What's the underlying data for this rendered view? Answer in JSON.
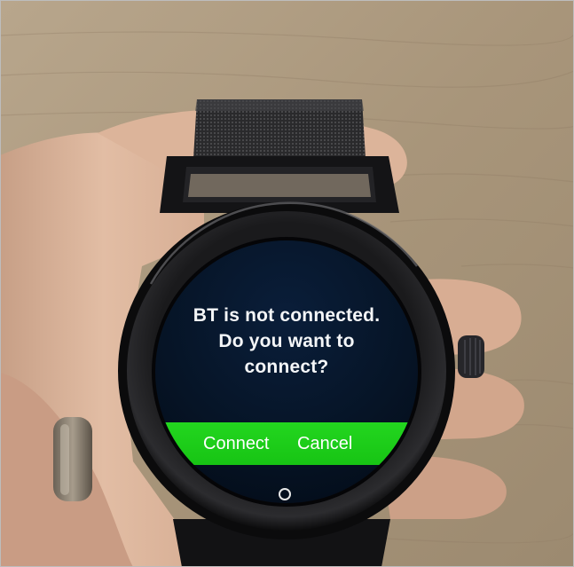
{
  "scene": {
    "subject": "smartwatch-held-in-hand",
    "accent_color": "#1fd11b",
    "screen_color": "#061426"
  },
  "dialog": {
    "lines": [
      "BT is not connected.",
      "Do you want to",
      "connect?"
    ],
    "connect_label": "Connect",
    "cancel_label": "Cancel"
  },
  "icons": {
    "home": "home-circle-icon"
  }
}
